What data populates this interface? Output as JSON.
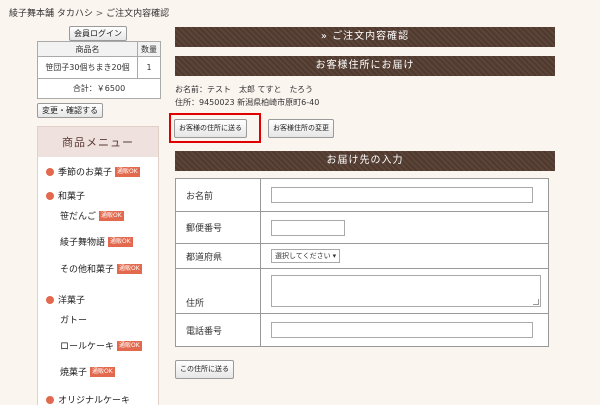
{
  "breadcrumb": {
    "home": "綾子舞本舗 タカハシ",
    "separator": ">",
    "current": "ご注文内容確認"
  },
  "sidebar": {
    "login_button": "会員ログイン",
    "cart": {
      "headers": [
        "商品名",
        "数量"
      ],
      "rows": [
        {
          "name": "笹団子30個ちまき20個",
          "qty": "1"
        }
      ],
      "total": "合計：￥6500"
    },
    "change_button": "変更・確認する",
    "menu": {
      "title": "商品メニュー",
      "badge": "通販OK",
      "items": [
        {
          "label": "季節のお菓子"
        },
        {
          "label": "和菓子"
        },
        {
          "label": "笹だんご"
        },
        {
          "label": "綾子舞物語"
        },
        {
          "label": "その他和菓子"
        },
        {
          "label": "洋菓子"
        },
        {
          "label": "ガトー"
        },
        {
          "label": "ロールケーキ"
        },
        {
          "label": "焼菓子"
        },
        {
          "label": "オリジナルケーキ"
        }
      ]
    }
  },
  "main": {
    "order_confirm_title": "» ご注文内容確認",
    "delivery_title": "お客様住所にお届け",
    "customer_name": "お名前：テスト　太郎 てすと　たろう",
    "customer_address": "住所：9450023 新潟県柏崎市原町6-40",
    "send_to_customer_button": "お客様の住所に送る",
    "change_address_button": "お客様住所の変更",
    "delivery_input_title": "お届け先の入力",
    "form": {
      "name_label": "お名前",
      "zip_label": "郵便番号",
      "prefecture_label": "都道府県",
      "prefecture_value": "選択してください",
      "address_label": "住所",
      "phone_label": "電話番号"
    },
    "send_here_button": "この住所に送る"
  },
  "icons": {
    "dropdown": "chevron-down-icon",
    "bullet": "dot-icon"
  },
  "colors": {
    "bar": "#5c4438",
    "accent": "#e3694e",
    "highlight": "#e00000",
    "page_bg": "#fbf5f0"
  }
}
